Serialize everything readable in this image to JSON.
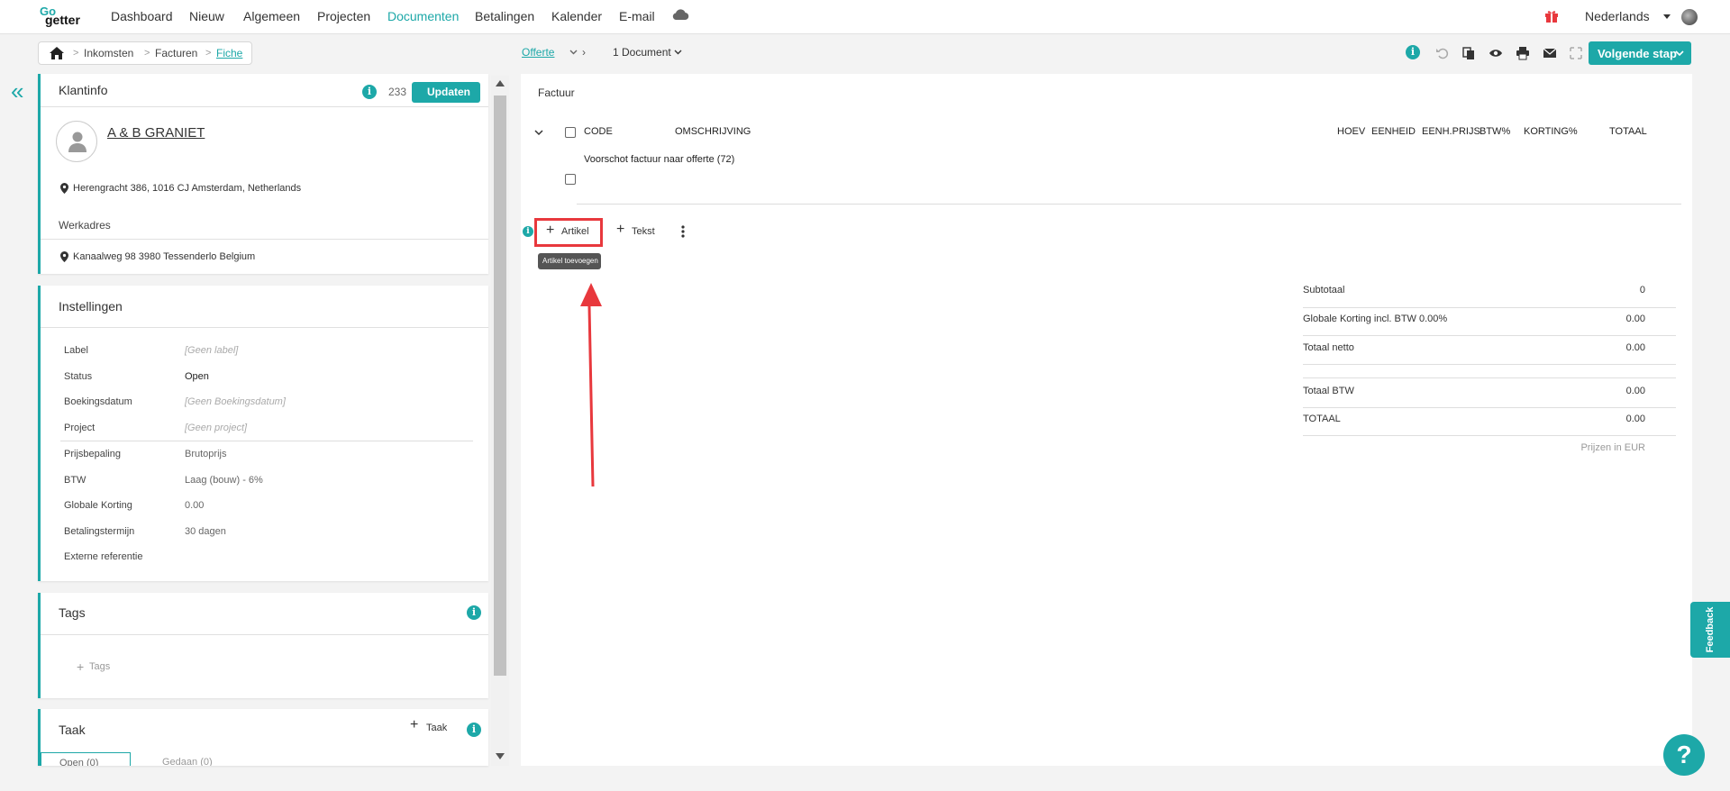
{
  "app": {
    "logo_top": "Go",
    "logo_bottom": "getter"
  },
  "nav": {
    "items": [
      "Dashboard",
      "Nieuw",
      "Algemeen",
      "Projecten",
      "Documenten",
      "Betalingen",
      "Kalender",
      "E-mail"
    ],
    "active": "Documenten",
    "language": "Nederlands"
  },
  "breadcrumb": {
    "items": [
      "Inkomsten",
      "Facturen",
      "Fiche"
    ]
  },
  "document_nav": {
    "offerte": "Offerte",
    "documents": "1 Document"
  },
  "toolbar": {
    "next_step": "Volgende stap"
  },
  "klantinfo": {
    "title": "Klantinfo",
    "count": "233",
    "update_button": "Updaten",
    "client_name": "A & B GRANIET",
    "address": "Herengracht 386, 1016 CJ Amsterdam, Netherlands",
    "werkadres_label": "Werkadres",
    "werkadres": "Kanaalweg 98 3980 Tessenderlo Belgium"
  },
  "instellingen": {
    "title": "Instellingen",
    "rows": [
      {
        "key": "Label",
        "value": "[Geen label]"
      },
      {
        "key": "Status",
        "value": "Open"
      },
      {
        "key": "Boekingsdatum",
        "value": "[Geen Boekingsdatum]"
      },
      {
        "key": "Project",
        "value": "[Geen project]"
      },
      {
        "key": "Prijsbepaling",
        "value": "Brutoprijs"
      },
      {
        "key": "BTW",
        "value": "Laag (bouw) - 6%"
      },
      {
        "key": "Globale Korting",
        "value": "0.00"
      },
      {
        "key": "Betalingstermijn",
        "value": "30 dagen"
      },
      {
        "key": "Externe referentie",
        "value": ""
      }
    ]
  },
  "tags": {
    "title": "Tags",
    "add_label": "Tags"
  },
  "taak": {
    "title": "Taak",
    "add_label": "Taak",
    "tabs": [
      "Open (0)",
      "Gedaan (0)"
    ]
  },
  "factuur": {
    "title": "Factuur",
    "columns": [
      "CODE",
      "OMSCHRIJVING",
      "HOEV",
      "EENHEID",
      "EENH.PRIJS",
      "BTW%",
      "KORTING%",
      "TOTAAL"
    ],
    "row_description": "Voorschot factuur naar offerte (72)",
    "add_article": "Artikel",
    "add_text": "Tekst",
    "tooltip": "Artikel toevoegen"
  },
  "totals": {
    "rows": [
      {
        "key": "Subtotaal",
        "value": "0"
      },
      {
        "key": "Globale Korting incl. BTW 0.00%",
        "value": "0.00"
      },
      {
        "key": "Totaal netto",
        "value": "0.00"
      },
      {
        "key": "Totaal BTW",
        "value": "0.00"
      },
      {
        "key": "TOTAAL",
        "value": "0.00"
      }
    ],
    "currency_note": "Prijzen in EUR"
  },
  "feedback": "Feedback",
  "help": "?",
  "colors": {
    "accent": "#1da8a8",
    "highlight": "#e8383d"
  }
}
